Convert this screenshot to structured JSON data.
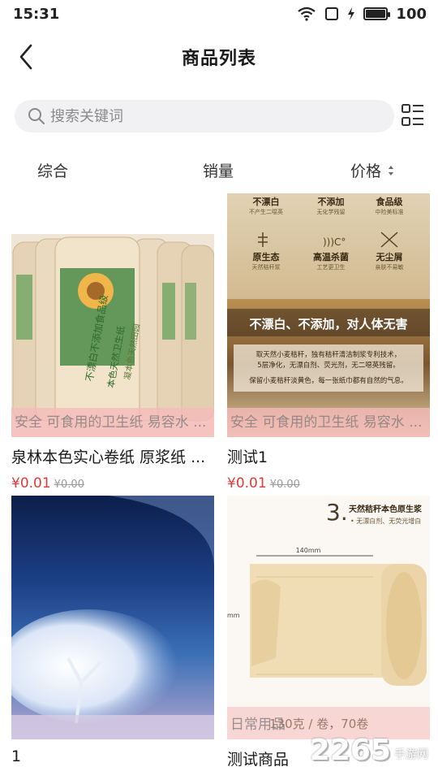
{
  "statusbar": {
    "time": "15:31",
    "battery_level": "100",
    "battery_fraction": 1.0
  },
  "header": {
    "title": "商品列表",
    "back_icon": "chevron-left-icon"
  },
  "search": {
    "placeholder": "搜索关键词",
    "value": "",
    "layout_icon": "list-layout-icon"
  },
  "sort": {
    "tabs": [
      {
        "label": "综合"
      },
      {
        "label": "销量"
      },
      {
        "label": "价格",
        "icon": "sort-arrows-icon"
      }
    ]
  },
  "products": [
    {
      "name": "泉林本色实心卷纸 原浆纸 ...",
      "tag": "安全 可食用的卫生纸 易容水 ...",
      "price": "¥0.01",
      "original_price": "¥0.00",
      "image": {
        "brand_text": "本色天然卫生纸",
        "pack_text": "不漂白不添加食品级",
        "side_text": "凝本色天然田园"
      }
    },
    {
      "name": "测试1",
      "tag": "安全 可食用的卫生纸 易容水 ...",
      "price": "¥0.01",
      "original_price": "¥0.00",
      "image": {
        "features": [
          {
            "title": "不漂白",
            "sub": "不产生二噁英"
          },
          {
            "title": "不添加",
            "sub": "无化学残留"
          },
          {
            "title": "食品级",
            "sub": "中险美标准"
          },
          {
            "title": "原生态",
            "sub": "天然秸秆浆"
          },
          {
            "title": "高温杀菌",
            "sub": "工艺更卫生"
          },
          {
            "title": "无尘屑",
            "sub": "亲肤不易敏"
          }
        ],
        "headline": "不漂白、不添加，对人体无害",
        "body_1": "取天然小麦秸秆，独有秸秆清洁制浆专利技术，",
        "body_2": "5层净化，无漂白剂、荧光剂，无二噁英残留。",
        "body_3": "保留小麦秸秆淡黄色，每一张纸巾都有自然的气息。"
      }
    },
    {
      "name": "1",
      "tag": "",
      "price": "",
      "original_price": "",
      "image": {}
    },
    {
      "name": "测试商品",
      "tag": "日常用品",
      "price": "",
      "original_price": "",
      "image": {
        "step_no": "3.",
        "heading": "天然秸秆本色原生浆",
        "subheading": "• 无漂白剂、无荧光增白",
        "dimension": "140mm",
        "side_dim": "mm",
        "spec": "130克 / 卷，70卷"
      }
    }
  ],
  "watermark": {
    "number": "2265",
    "suffix": "手游网"
  },
  "colors": {
    "price": "#e53935",
    "tag_bg": "#f6baba",
    "search_bg": "#f1f1f3"
  }
}
